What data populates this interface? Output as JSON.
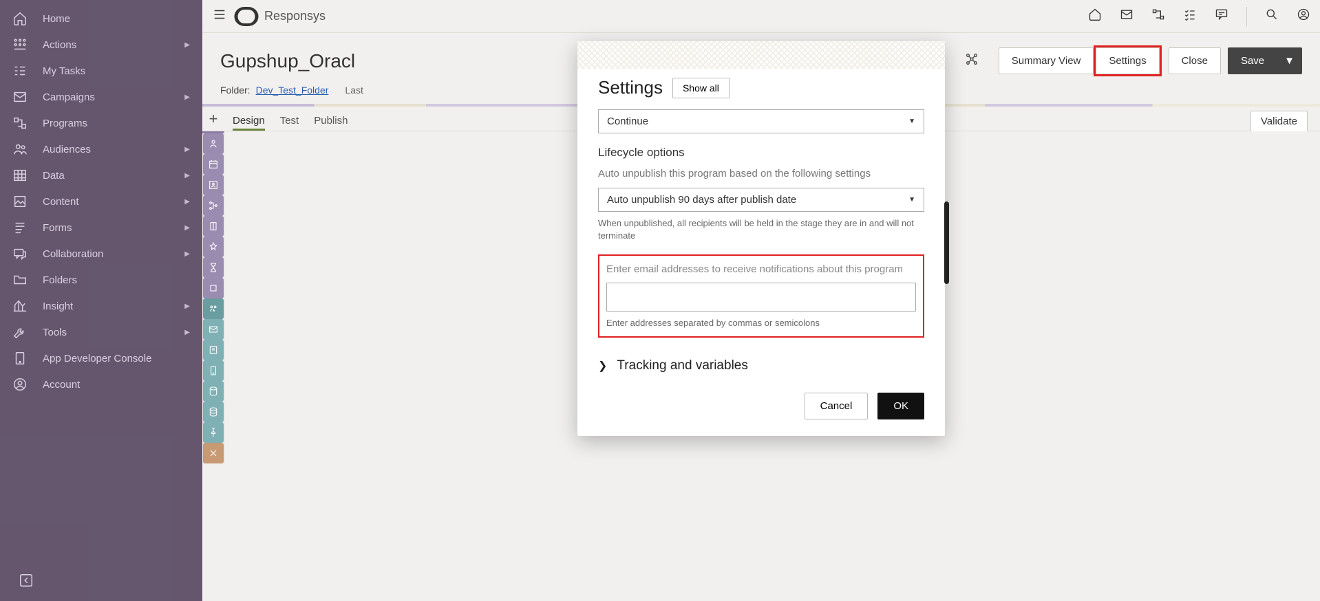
{
  "brand": "Responsys",
  "sidebar": {
    "items": [
      {
        "label": "Home"
      },
      {
        "label": "Actions",
        "caret": true
      },
      {
        "label": "My Tasks"
      },
      {
        "label": "Campaigns",
        "caret": true
      },
      {
        "label": "Programs"
      },
      {
        "label": "Audiences",
        "caret": true
      },
      {
        "label": "Data",
        "caret": true
      },
      {
        "label": "Content",
        "caret": true
      },
      {
        "label": "Forms",
        "caret": true
      },
      {
        "label": "Collaboration",
        "caret": true
      },
      {
        "label": "Folders"
      },
      {
        "label": "Insight",
        "caret": true
      },
      {
        "label": "Tools",
        "caret": true
      },
      {
        "label": "App Developer Console"
      },
      {
        "label": "Account"
      }
    ]
  },
  "page": {
    "title": "Gupshup_Oracl",
    "folder_label": "Folder:",
    "folder_value": "Dev_Test_Folder",
    "last_label": "Last"
  },
  "actions": {
    "summary_view": "Summary View",
    "settings": "Settings",
    "close": "Close",
    "save": "Save",
    "validate": "Validate"
  },
  "tabs": {
    "design": "Design",
    "test": "Test",
    "publish": "Publish"
  },
  "modal": {
    "title": "Settings",
    "show_all": "Show all",
    "continue_select": "Continue",
    "lifecycle_title": "Lifecycle options",
    "auto_unpublish_label": "Auto unpublish this program based on the following settings",
    "auto_unpublish_value": "Auto unpublish 90 days after publish date",
    "auto_unpublish_helper": "When unpublished, all recipients will be held in the stage they are in and will not terminate",
    "email_label": "Enter email addresses to receive notifications about this program",
    "email_value": "",
    "email_placeholder": "",
    "email_helper": "Enter addresses separated by commas or semicolons",
    "tracking_label": "Tracking and variables",
    "cancel": "Cancel",
    "ok": "OK"
  }
}
